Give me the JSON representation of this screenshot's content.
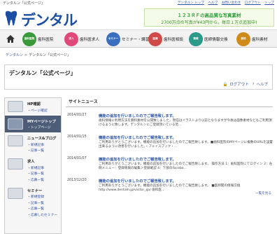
{
  "top": {
    "site_label": "デンタルン「公式ページ」",
    "links": [
      "デンタルン トップ",
      "ヘルプ",
      "お問い合わせ",
      "ログアウト",
      "トップ"
    ]
  },
  "logo": {
    "text": "デンタルン"
  },
  "ad": {
    "line1": "１２３ＲＦの高品質な写真素材",
    "line2": "2700万点の写真が¥43円から。毎日１万点追加中!"
  },
  "nav": {
    "items": [
      {
        "badge": "歯科医院",
        "label": "歯科医院",
        "color": "#3a9a3a"
      },
      {
        "badge": "求人",
        "label": "歯科医求人",
        "color": "#e04a7a"
      },
      {
        "badge": "セミナー",
        "label": "セミナー・講習会",
        "color": "#3a6fc0"
      },
      {
        "badge": "医療",
        "label": "歯科医相談",
        "color": "#d04a4a"
      },
      {
        "badge": "情報",
        "label": "医師情報交換",
        "color": "#2a9a8a"
      },
      {
        "badge": "素材",
        "label": "歯科素材",
        "color": "#d08a1a"
      }
    ]
  },
  "breadcrumb": {
    "home": "デンタルン",
    "current": "デンタルン「公式ページ」"
  },
  "heading": {
    "title": "デンタルン「公式ページ」",
    "logout": "ログアウト",
    "help": "ヘルプ"
  },
  "sidebar": [
    {
      "title": "HP確認",
      "links": [
        "ページ確認"
      ],
      "active": false
    },
    {
      "title": "MYページトップ",
      "links": [
        "トップページ"
      ],
      "active": true
    },
    {
      "title": "ニュース&ブログ",
      "links": [
        "新規記事",
        "記事一覧"
      ],
      "active": false
    },
    {
      "title": "求人",
      "links": [
        "新規記事",
        "記事一覧",
        "応募一覧"
      ],
      "active": false
    },
    {
      "title": "セミナー",
      "links": [
        "新規登録",
        "記事一覧",
        "応募一覧",
        "応募したセミナー"
      ],
      "active": false
    }
  ],
  "news": {
    "section_title": "サイトニュース",
    "items": [
      {
        "date": "2014/01/27",
        "title": "機能の追加を行いましたのでご報告致します。",
        "body": "歯科情報に利用方法を無料素材を公開致しました。現在はイラストより以前となりますが今後は画像素材などもご利用頂けるように致します。デンタルンにご登録頂いている皆..."
      },
      {
        "date": "2014/01/15",
        "title": "機能の追加を行いましたのでご報告致します。",
        "body": "ご利用ありがとうございます。機能の追加を行いましたのでご報告致します。■歯科医院のMYページに複数のURLを設置出来るように改善を行いました。・フェイスブック・..."
      },
      {
        "date": "2014/01/07",
        "title": "機能の追加を行いましたのでご報告致します。",
        "body": "ご利用ありがとうございます。機能の追加を行いましたのでご報告致します。 操作方法 1：歯科医院にてログイン 2：左側メニュー：登録情報の編集＞登録確認 4：下部のFacebo..."
      },
      {
        "date": "2013/12/20",
        "title": "機能の追加を行いましたのでご報告致します。",
        "body": "ご利用ありがとうございます。機能の追加を行いましたのでご報告致します。 ■医師間の情報交換http://www.dentaln.jp/visitor_qa/ 歯科医..."
      }
    ],
    "more": "一覧を見る"
  },
  "colors": {
    "accent": "#1b4fa3",
    "link": "#3355aa",
    "sidebar_active": "#4d5d77"
  }
}
